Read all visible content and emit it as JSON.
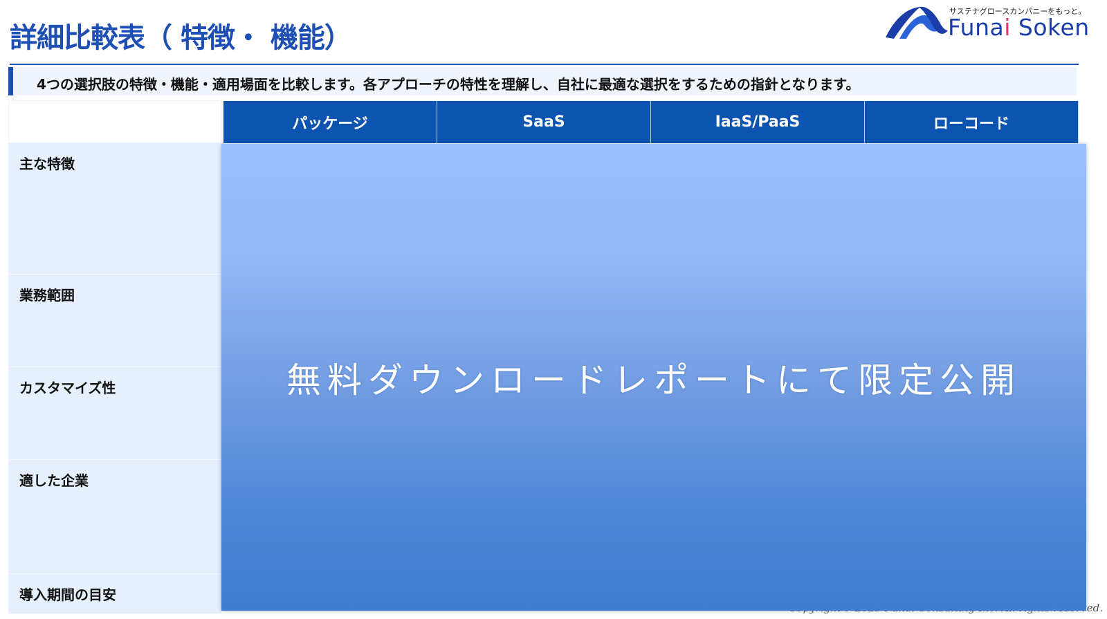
{
  "page": {
    "title": "詳細比較表（ 特徴・ 機能）",
    "subtitle": "4つの選択肢の特徴・機能・適用場面を比較します。各アプローチの特性を理解し、自社に最適な選択をするための指針となります。"
  },
  "logo": {
    "tagline": "サステナグロースカンパニーをもっと。",
    "wordmark_pre": "Funa",
    "wordmark_dot": "i",
    "wordmark_post": " Soken"
  },
  "table": {
    "columns": [
      "パッケージ",
      "SaaS",
      "IaaS/PaaS",
      "ローコード"
    ],
    "rows": [
      "主な特徴",
      "業務範囲",
      "カスタマイズ性",
      "適した企業",
      "導入期間の目安"
    ]
  },
  "overlay": {
    "text": "無料ダウンロードレポートにて限定公開"
  },
  "footer": {
    "copyright": "Copyright© 2025 Funai Consulting Inc. All rights reserved."
  },
  "colors": {
    "brand_blue": "#1e4fb4",
    "header_blue": "#0d53b0",
    "row_label_bg": "#e6effd",
    "logo_accent": "#e0306a"
  }
}
